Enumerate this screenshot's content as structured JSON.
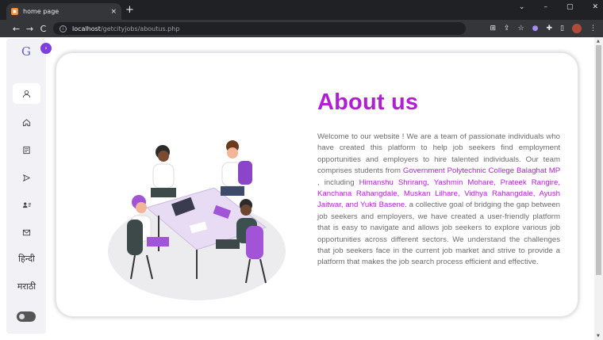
{
  "browser": {
    "tab_title": "home page",
    "tab_close": "×",
    "new_tab": "+",
    "window_buttons": [
      "⌄",
      "–",
      "▢",
      "✕"
    ],
    "nav": {
      "back": "←",
      "forward": "→",
      "reload": "C"
    },
    "url_host": "localhost",
    "url_path": "/getcityjobs/aboutus.php"
  },
  "sidebar": {
    "logo_text": "G",
    "expand_icon": "chevron-right-icon",
    "items": [
      {
        "icon": "user-icon",
        "glyph": "⚇"
      },
      {
        "icon": "home-icon",
        "glyph": "⌂"
      },
      {
        "icon": "document-icon",
        "glyph": "☰"
      },
      {
        "icon": "send-icon",
        "glyph": "▷"
      },
      {
        "icon": "contacts-icon",
        "glyph": "⚉"
      },
      {
        "icon": "mail-icon",
        "glyph": "✉"
      }
    ],
    "hindi_label": "हिन्दी",
    "marathi_label": "मराठी"
  },
  "about": {
    "title": "About us",
    "p1": "Welcome to our website ! We are a team of passionate individuals who have created this platform to help job seekers find employment opportunities and employers to hire talented individuals. Our team comprises students from ",
    "college": "Government Polytechnic College Balaghat MP",
    "p2": " , including ",
    "names": "Himanshu Shrirang, Yashmin Mohare, Prateek Rangire, Kanchana Rahangdale, Muskan Lilhare, Vidhya Rahangdale, Ayush Jaitwar, and Yukti Basene",
    "p3": ". a collective goal of bridging the gap between job seekers and employers, we have created a user-friendly platform that is easy to navigate and allows job seekers to explore various job opportunities across different sectors. We understand the challenges that job seekers face in the current job market and strive to provide a platform that makes the job search process efficient and effective."
  },
  "colors": {
    "accent": "#b21ed3",
    "sidebar_bg": "#f1f1f6",
    "chrome": "#202124"
  }
}
